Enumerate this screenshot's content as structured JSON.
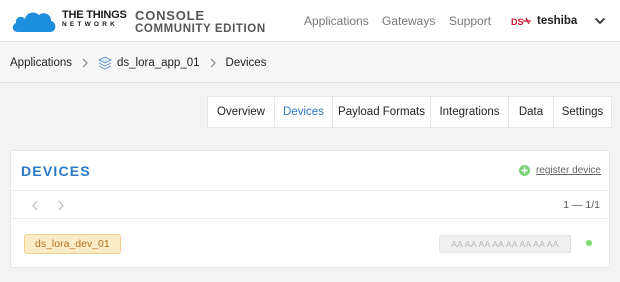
{
  "brand": {
    "line1": "THE THINGS",
    "line2": "NETWORK",
    "console_line1": "CONSOLE",
    "console_line2": "COMMUNITY EDITION"
  },
  "nav": {
    "items": [
      {
        "label": "Applications"
      },
      {
        "label": "Gateways"
      },
      {
        "label": "Support"
      }
    ],
    "user": {
      "name": "teshiba"
    }
  },
  "breadcrumb": {
    "items": [
      {
        "label": "Applications"
      },
      {
        "label": "ds_lora_app_01"
      },
      {
        "label": "Devices"
      }
    ]
  },
  "tabs": [
    {
      "label": "Overview",
      "active": false
    },
    {
      "label": "Devices",
      "active": true
    },
    {
      "label": "Payload Formats",
      "active": false
    },
    {
      "label": "Integrations",
      "active": false
    },
    {
      "label": "Data",
      "active": false
    },
    {
      "label": "Settings",
      "active": false
    }
  ],
  "devices_panel": {
    "title": "DEVICES",
    "register_label": "register device",
    "pagination": "1 — 1/1",
    "rows": [
      {
        "device_id": "ds_lora_dev_01",
        "dev_eui": "AA AA AA AA AA AA AA AA",
        "status": "online"
      }
    ]
  },
  "colors": {
    "accent": "#2a78c5",
    "logo": "#1d8fdc",
    "tag_text": "#b3701d",
    "tag_bg": "#fcecc6",
    "status_online": "#7fdd6a",
    "register_icon": "#7ed07a"
  },
  "icons": {
    "logo": "cloud-logo-icon",
    "caret": "chevron-down-icon",
    "app": "stack-icon",
    "add": "plus-circle-icon",
    "prev": "chevron-left-icon",
    "next": "chevron-right-icon"
  }
}
